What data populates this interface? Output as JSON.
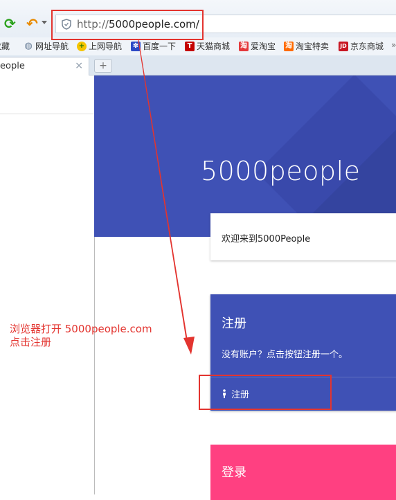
{
  "browser": {
    "url_proto": "http://",
    "url_host": "5000people.com/",
    "bookmarks": [
      {
        "label": "收藏",
        "icon": "star"
      },
      {
        "label": "网址导航",
        "icon": "globe"
      },
      {
        "label": "上网导航",
        "icon": "plus"
      },
      {
        "label": "百度一下",
        "icon": "paw"
      },
      {
        "label": "天猫商城",
        "icon": "T"
      },
      {
        "label": "爱淘宝",
        "icon": "淘"
      },
      {
        "label": "淘宝特卖",
        "icon": "淘"
      },
      {
        "label": "京东商城",
        "icon": "JD"
      }
    ],
    "tab_title": "eople",
    "tab_close": "×",
    "new_tab": "+"
  },
  "page": {
    "brand": "5000people",
    "welcome": "欢迎来到5000People",
    "register_card": {
      "title": "注册",
      "desc": "没有账户？点击按钮注册一个。",
      "button": "注册"
    },
    "login_card": {
      "title": "登录"
    }
  },
  "annotation": {
    "line1": "浏览器打开 5000people.com",
    "line2": "点击注册"
  },
  "colors": {
    "primary": "#3f51b5",
    "accent": "#ff4081",
    "annotation": "#e3342f"
  }
}
